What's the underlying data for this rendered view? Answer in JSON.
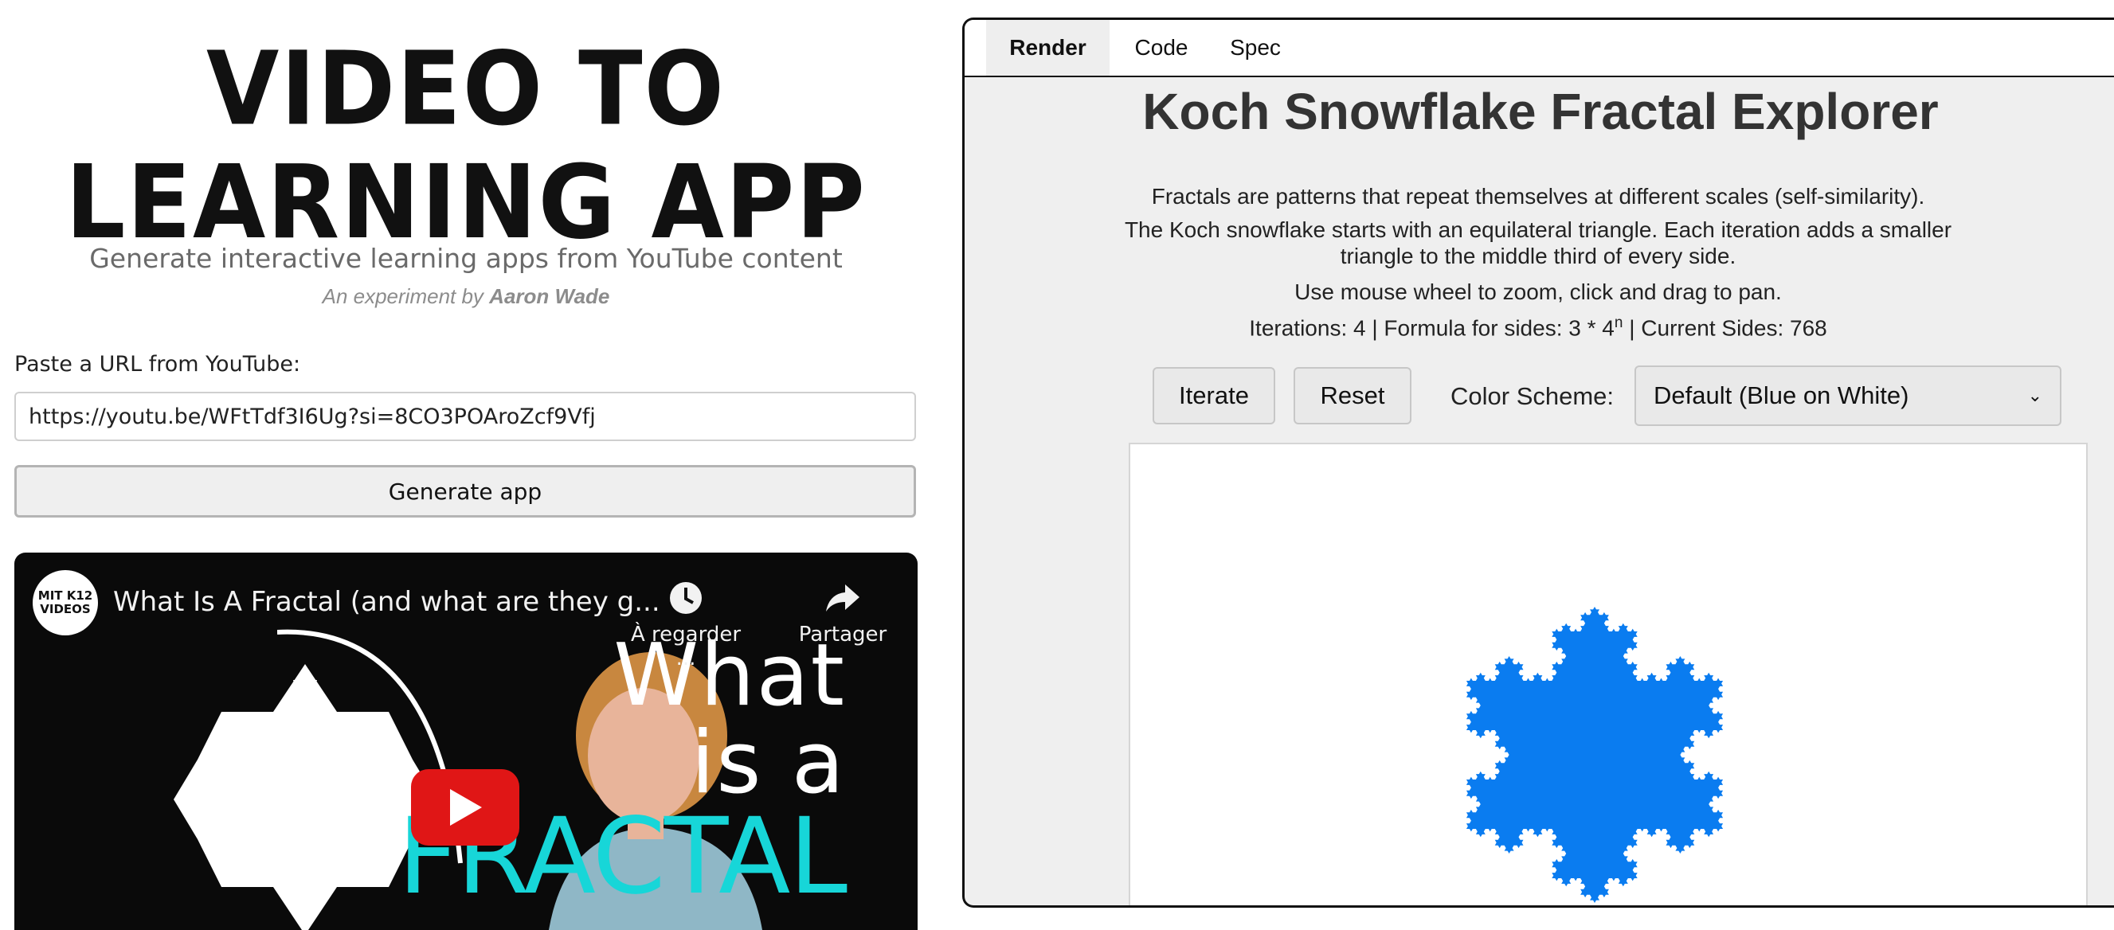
{
  "left": {
    "hero_title_line1": "VIDEO TO",
    "hero_title_line2": "LEARNING APP",
    "subtitle": "Generate interactive learning apps from YouTube content",
    "credit_prefix": "An experiment by",
    "credit_name": "Aaron Wade",
    "url_label": "Paste a URL from YouTube:",
    "url_value": "https://youtu.be/WFtTdf3I6Ug?si=8CO3POAroZcf9Vfj",
    "generate_button": "Generate app"
  },
  "video": {
    "channel_logo_text": "MIT K12 VIDEOS",
    "title": "What Is A Fractal (and what are they g...",
    "watch_later_label": "À regarder ...",
    "share_label": "Partager",
    "thumb_line1": "What",
    "thumb_line2": "is a",
    "thumb_line3": "FRACTAL",
    "icons": [
      "clock-icon",
      "share-arrow-icon",
      "youtube-play-icon"
    ]
  },
  "right": {
    "tabs": [
      {
        "label": "Render",
        "active": true
      },
      {
        "label": "Code",
        "active": false
      },
      {
        "label": "Spec",
        "active": false
      }
    ],
    "app_title": "Koch Snowflake Fractal Explorer",
    "desc1": "Fractals are patterns that repeat themselves at different scales (self-similarity).",
    "desc2": "The Koch snowflake starts with an equilateral triangle. Each iteration adds a smaller triangle to the middle third of every side.",
    "desc3": "Use mouse wheel to zoom, click and drag to pan.",
    "stats_prefix": "Iterations: 4 | Formula for sides: 3 * 4",
    "stats_exp": "n",
    "stats_suffix": " | Current Sides: 768",
    "iterate_button": "Iterate",
    "reset_button": "Reset",
    "color_label": "Color Scheme:",
    "color_selected": "Default (Blue on White)",
    "iterations": 4,
    "fill_color": "#0a7cf0",
    "canvas_bg": "#ffffff"
  }
}
